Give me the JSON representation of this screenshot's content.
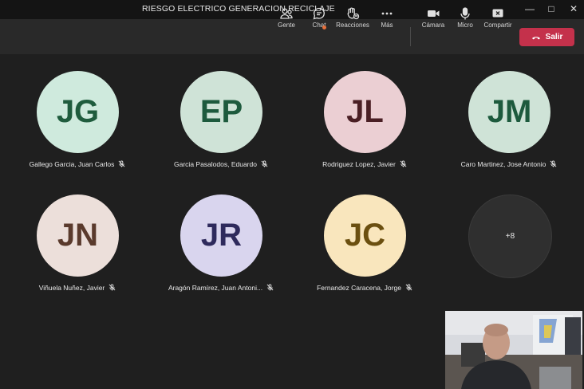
{
  "window": {
    "title": "RIESGO ELECTRICO GENERACION RECICLAJE"
  },
  "toolbar": {
    "people": "Gente",
    "chat": "Chat",
    "reactions": "Reacciones",
    "more": "Más",
    "camera": "Cámara",
    "mic": "Micro",
    "share": "Compartir",
    "leave": "Salir"
  },
  "participants": [
    {
      "initials": "JG",
      "name": "Gallego Garcia, Juan Carlos",
      "bg": "#cfeadd",
      "fg": "#1f5c3d"
    },
    {
      "initials": "EP",
      "name": "Garcia Pasalodos, Eduardo",
      "bg": "#cfe3d7",
      "fg": "#1d5a3d"
    },
    {
      "initials": "JL",
      "name": "Rodriguez Lopez, Javier",
      "bg": "#ebcfd3",
      "fg": "#4a1f24"
    },
    {
      "initials": "JM",
      "name": "Caro Martinez, Jose Antonio",
      "bg": "#cfe3d7",
      "fg": "#1d5a3d"
    },
    {
      "initials": "JN",
      "name": "Viñuela Nuñez, Javier",
      "bg": "#ecdfda",
      "fg": "#5a3a2c"
    },
    {
      "initials": "JR",
      "name": "Aragón Ramírez, Juan Antoni...",
      "bg": "#d9d5ee",
      "fg": "#2e2a5c"
    },
    {
      "initials": "JC",
      "name": "Fernandez Caracena, Jorge",
      "bg": "#f9e6bd",
      "fg": "#6b4f10"
    }
  ],
  "overflow": {
    "label": "+8"
  }
}
